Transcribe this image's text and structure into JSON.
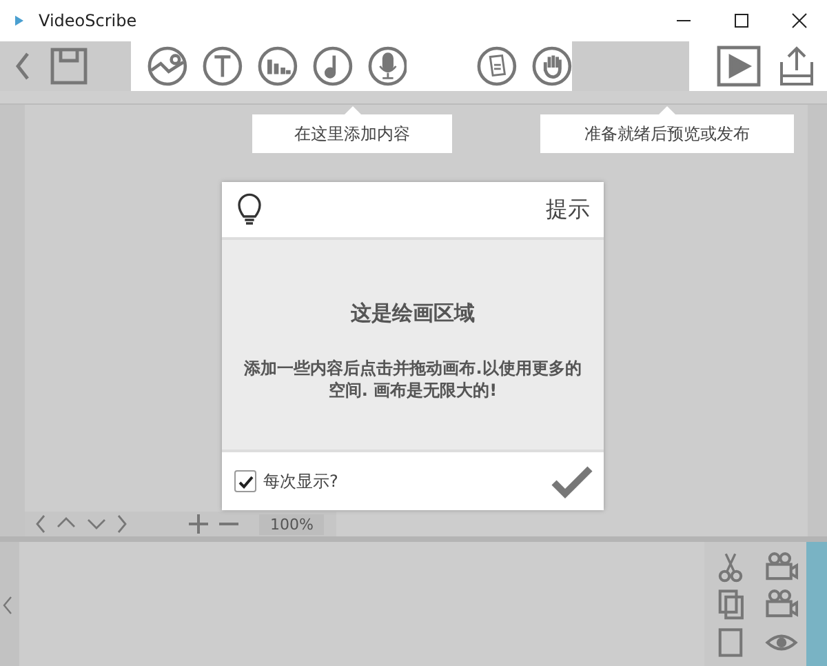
{
  "window": {
    "title": "VideoScribe"
  },
  "tooltips": [
    {
      "text": "在这里添加内容"
    },
    {
      "text": "准备就绪后预览或发布"
    }
  ],
  "dialog": {
    "title": "提示",
    "heading": "这是绘画区域",
    "body": "添加一些内容后点击并拖动画布.以使用更多的空间. 画布是无限大的!",
    "show_every_time": {
      "label": "每次显示?",
      "checked": true
    }
  },
  "canvas_nav": {
    "zoom": "100%"
  }
}
